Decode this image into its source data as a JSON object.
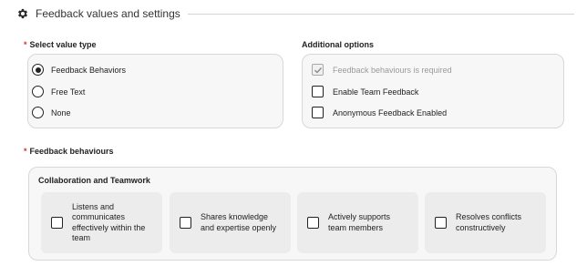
{
  "header": {
    "title": "Feedback values and settings",
    "icon": "gear-icon"
  },
  "value_type": {
    "label": "Select value type",
    "required_mark": "*",
    "options": [
      {
        "label": "Feedback Behaviors",
        "selected": true
      },
      {
        "label": "Free Text",
        "selected": false
      },
      {
        "label": "None",
        "selected": false
      }
    ]
  },
  "additional_options": {
    "label": "Additional options",
    "options": [
      {
        "label": "Feedback behaviours is required",
        "checked": true,
        "disabled": true
      },
      {
        "label": "Enable Team Feedback",
        "checked": false,
        "disabled": false
      },
      {
        "label": "Anonymous Feedback Enabled",
        "checked": false,
        "disabled": false
      }
    ]
  },
  "behaviours": {
    "label": "Feedback behaviours",
    "required_mark": "*",
    "group_title": "Collaboration and Teamwork",
    "cards": [
      {
        "lines": [
          "Listens and",
          "communicates",
          "effectively within the",
          "team"
        ],
        "checked": false
      },
      {
        "lines": [
          "Shares knowledge",
          "and expertise openly"
        ],
        "checked": false
      },
      {
        "lines": [
          "Actively supports",
          "team members"
        ],
        "checked": false
      },
      {
        "lines": [
          "Resolves conflicts",
          "constructively"
        ],
        "checked": false
      }
    ]
  },
  "colors": {
    "required": "#d0342c",
    "panel_bg": "#f7f7f7",
    "card_bg": "#ececec",
    "disabled_text": "#9a9a9a"
  }
}
